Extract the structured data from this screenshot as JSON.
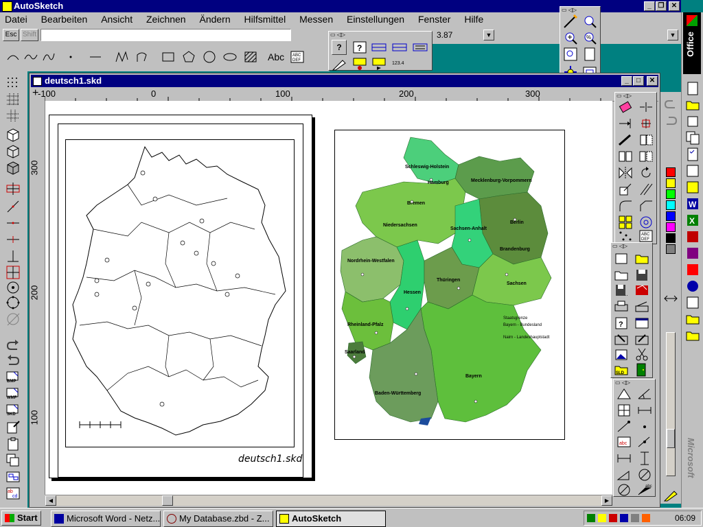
{
  "app": {
    "title": "AutoSketch"
  },
  "menu": [
    "Datei",
    "Bearbeiten",
    "Ansicht",
    "Zeichnen",
    "Ändern",
    "Hilfsmittel",
    "Messen",
    "Einstellungen",
    "Fenster",
    "Hilfe"
  ],
  "command": {
    "esc_label": "Esc",
    "shift_label": "Shift",
    "coord_value": "3.87"
  },
  "document": {
    "title": "deutsch1.skd",
    "caption": "deutsch1.skd"
  },
  "ruler": {
    "top_ticks": [
      "-100",
      "0",
      "100",
      "200",
      "300"
    ],
    "left_ticks": [
      "300",
      "200",
      "100"
    ]
  },
  "map": {
    "states": [
      "Schleswig-Holstein",
      "Hamburg",
      "Mecklenburg-Vorpommern",
      "Bremen",
      "Niedersachsen",
      "Sachsen-Anhalt",
      "Berlin",
      "Brandenburg",
      "Nordrhein-Westfalen",
      "Hessen",
      "Thüringen",
      "Sachsen",
      "Rheinland-Pfalz",
      "Saarland",
      "Baden-Württemberg",
      "Bayern"
    ],
    "legend": [
      "Staatsgrenze",
      "Bayern - Bundesland",
      "Nairn - Landeshauptstadt"
    ]
  },
  "right_toolbar": {
    "export_labels": [
      "BMP",
      "WMF",
      "SKD"
    ],
    "slide_label": "SLD"
  },
  "office_bar": {
    "title": "Office",
    "brand": "Microsoft"
  },
  "palette": {
    "colors": [
      "#ff0000",
      "#ffff00",
      "#00ff00",
      "#00ffff",
      "#0000ff",
      "#ff00ff",
      "#000000",
      "#808080"
    ]
  },
  "taskbar": {
    "start": "Start",
    "tasks": [
      "Microsoft Word - Netz...",
      "My Database.zbd - Z...",
      "AutoSketch"
    ],
    "clock": "06:09"
  }
}
